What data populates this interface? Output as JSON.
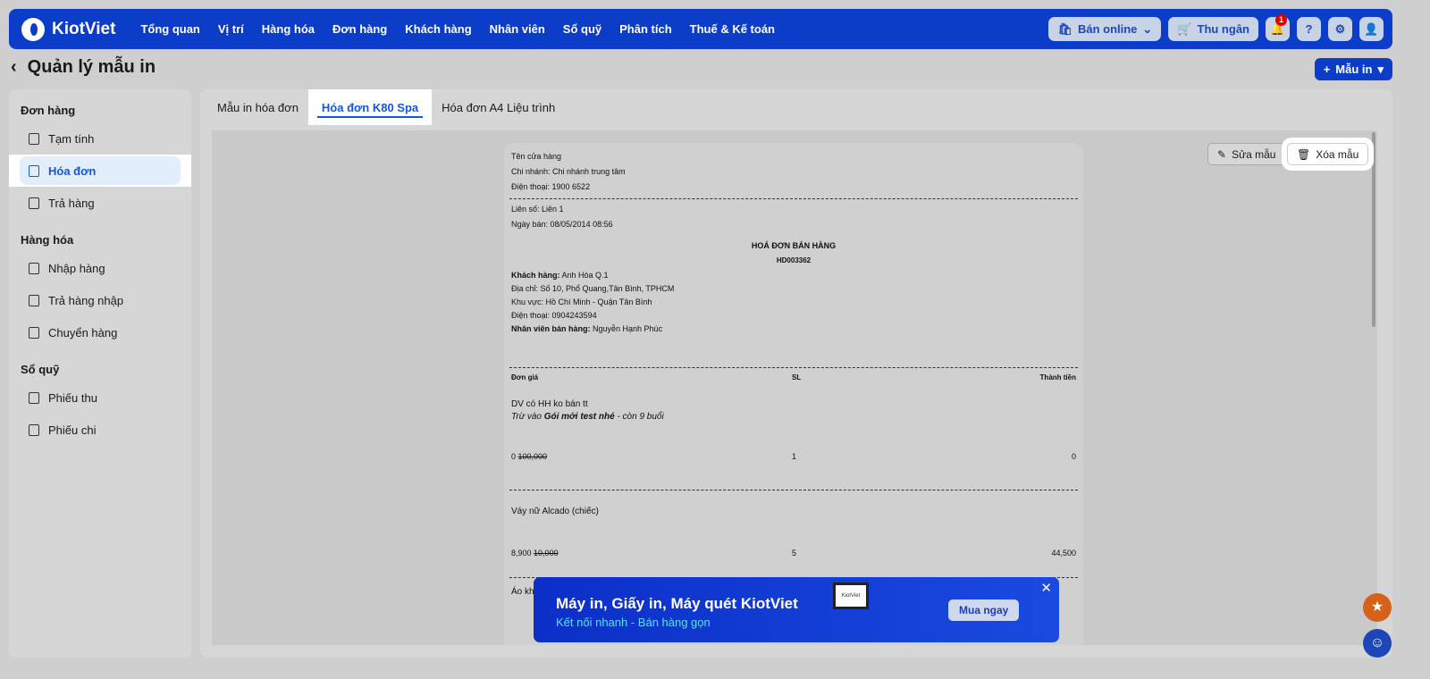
{
  "header": {
    "logo": "KiotViet",
    "nav": [
      "Tổng quan",
      "Vị trí",
      "Hàng hóa",
      "Đơn hàng",
      "Khách hàng",
      "Nhân viên",
      "Sổ quỹ",
      "Phân tích",
      "Thuế & Kế toán"
    ],
    "ban_online": "Bán online",
    "thu_ngan": "Thu ngân",
    "notif_count": "1"
  },
  "page": {
    "title": "Quản lý mẫu in",
    "add_button": "Mẫu in"
  },
  "sidebar": {
    "groups": [
      {
        "label": "Đơn hàng",
        "items": [
          "Tạm tính",
          "Hóa đơn",
          "Trả hàng"
        ]
      },
      {
        "label": "Hàng hóa",
        "items": [
          "Nhập hàng",
          "Trả hàng nhập",
          "Chuyển hàng"
        ]
      },
      {
        "label": "Sổ quỹ",
        "items": [
          "Phiếu thu",
          "Phiếu chi"
        ]
      }
    ]
  },
  "tabs": [
    "Mẫu in hóa đơn",
    "Hóa đơn K80 Spa",
    "Hóa đơn A4 Liệu trình"
  ],
  "actions": {
    "edit": "Sửa mẫu",
    "delete": "Xóa mẫu"
  },
  "receipt": {
    "store": "Tên cửa hàng",
    "branch": "Chi nhánh: Chi nhánh trung tâm",
    "phone": "Điện thoại: 1900 6522",
    "copy": "Liên số: Liên 1",
    "date": "Ngày bán: 08/05/2014 08:56",
    "title": "HOÁ ĐƠN BÁN HÀNG",
    "code": "HD003362",
    "customer_label": "Khách hàng:",
    "customer": " Anh Hòa Q.1",
    "address": "Địa chỉ: Số 10, Phổ Quang,Tân Bình, TPHCM",
    "area": "Khu vực: Hồ Chí Minh - Quận Tân Bình",
    "cust_phone": "Điện thoại: 0904243594",
    "staff_label": "Nhân viên bán hàng:",
    "staff": " Nguyễn Hạnh Phúc",
    "cols": [
      "Đơn giá",
      "SL",
      "Thành tiền"
    ],
    "items": [
      {
        "name": "DV có HH ko bán tt",
        "note_a": "Trừ vào ",
        "note_b": "Gói mới test nhé",
        "note_c": " - còn 9 buổi",
        "price": "0",
        "old_price": "100,000",
        "qty": "1",
        "total": "0"
      },
      {
        "name": "Váy nữ Alcado (chiếc)",
        "price": "8,900",
        "old_price": "10,000",
        "qty": "5",
        "total": "44,500"
      }
    ],
    "next_item": "Áo kh"
  },
  "banner": {
    "title": "Máy in, Giấy in, Máy quét KiotViet",
    "subtitle": "Kết nối nhanh - Bán hàng gọn",
    "button": "Mua ngay",
    "screen_brand": "KiotViet"
  }
}
